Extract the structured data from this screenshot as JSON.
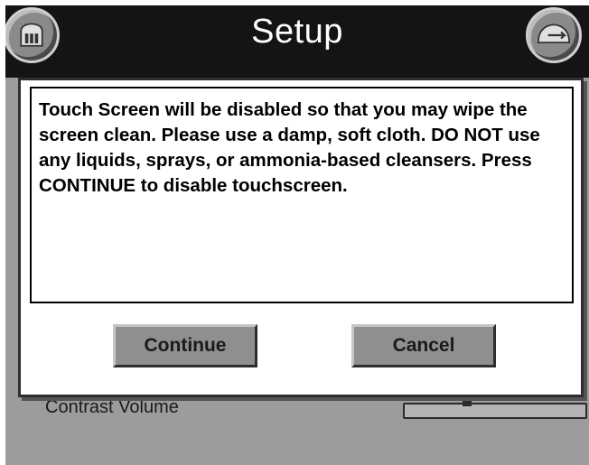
{
  "header": {
    "title": "Setup",
    "home_icon": "home-icon",
    "back_icon": "back-icon"
  },
  "background": {
    "row_label": "Contrast Volume"
  },
  "dialog": {
    "message": "Touch Screen will be disabled so that you may wipe the screen clean. Please use a damp, soft cloth. DO NOT use any liquids, sprays, or ammonia-based cleansers. Press CONTINUE to disable touchscreen.",
    "continue_label": "Continue",
    "cancel_label": "Cancel"
  },
  "colors": {
    "title_bar": "#141414",
    "background": "#9c9c9c",
    "button": "#8f8f8f",
    "dialog": "#ffffff"
  }
}
